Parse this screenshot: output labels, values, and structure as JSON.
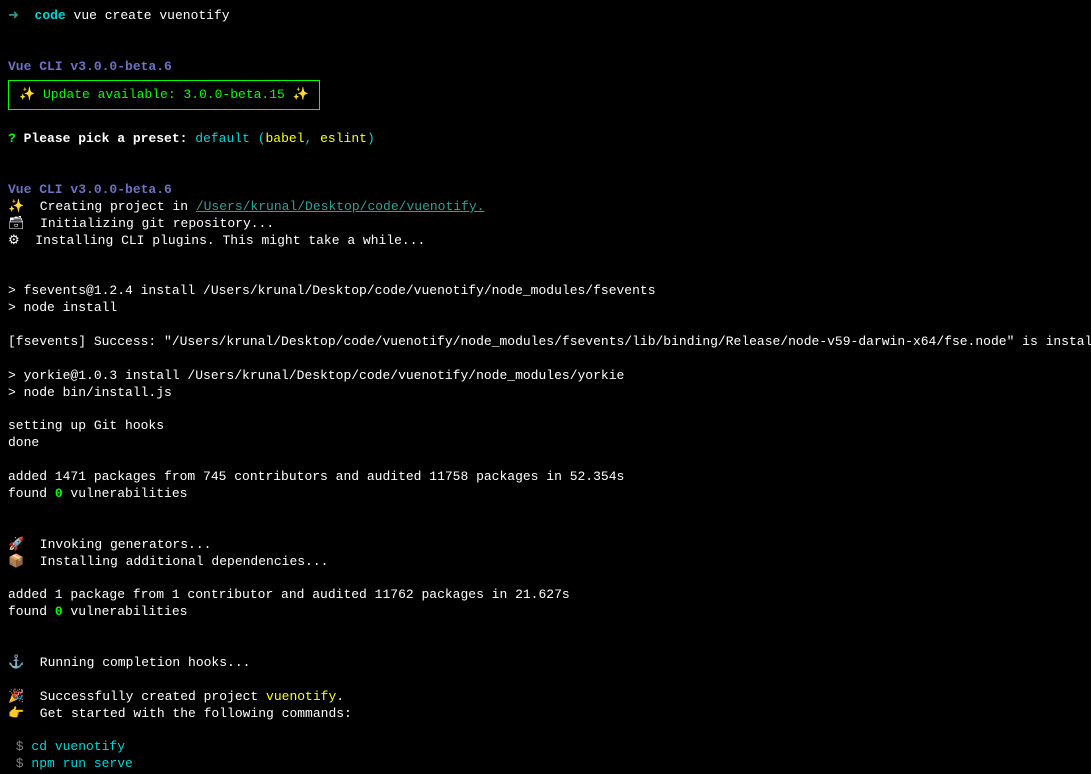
{
  "prompt": {
    "arrow": "➜",
    "code": "code",
    "command": "vue create vuenotify"
  },
  "cli": {
    "version_line": "Vue CLI v3.0.0-beta.6",
    "update_text": "Update available: 3.0.0-beta.15"
  },
  "preset": {
    "question": "?",
    "prompt": "Please pick a preset:",
    "default": "default",
    "open_paren": "(",
    "babel": "babel",
    "comma": ", ",
    "eslint": "eslint",
    "close_paren": ")"
  },
  "creating": {
    "version": "Vue CLI v3.0.0-beta.6",
    "creating_text": "Creating project in ",
    "creating_path": "/Users/krunal/Desktop/code/vuenotify.",
    "git_init": "Initializing git repository...",
    "plugins": "Installing CLI plugins. This might take a while..."
  },
  "install": {
    "fsevents_install": "> fsevents@1.2.4 install /Users/krunal/Desktop/code/vuenotify/node_modules/fsevents",
    "node_install": "> node install",
    "fsevents_success": "[fsevents] Success: \"/Users/krunal/Desktop/code/vuenotify/node_modules/fsevents/lib/binding/Release/node-v59-darwin-x64/fse.node\" is installed via remote",
    "yorkie_install": "> yorkie@1.0.3 install /Users/krunal/Desktop/code/vuenotify/node_modules/yorkie",
    "node_bin": "> node bin/install.js",
    "git_hooks": "setting up Git hooks",
    "done": "done",
    "added1_pre": "added 1471 packages from 745 contributors and audited 11758 packages in 52.354s",
    "found1_pre": "found ",
    "found1_num": "0",
    "found1_post": " vulnerabilities"
  },
  "generators": {
    "invoking": "Invoking generators...",
    "installing": "Installing additional dependencies...",
    "added2": "added 1 package from 1 contributor and audited 11762 packages in 21.627s",
    "found2_pre": "found ",
    "found2_num": "0",
    "found2_post": " vulnerabilities"
  },
  "completion": {
    "hooks": "Running completion hooks...",
    "success_pre": "Successfully created project ",
    "success_name": "vuenotify",
    "success_post": ".",
    "get_started": "Get started with the following commands:"
  },
  "commands": {
    "dollar1": " $",
    "cd": " cd vuenotify",
    "dollar2": " $",
    "serve": " npm run serve"
  },
  "emoji": {
    "sparkle": "✨",
    "hammer": "🗃",
    "gear": "⚙",
    "rocket": "🚀",
    "package": "📦",
    "anchor": "⚓",
    "tada": "🎉",
    "pointer": "👉"
  }
}
